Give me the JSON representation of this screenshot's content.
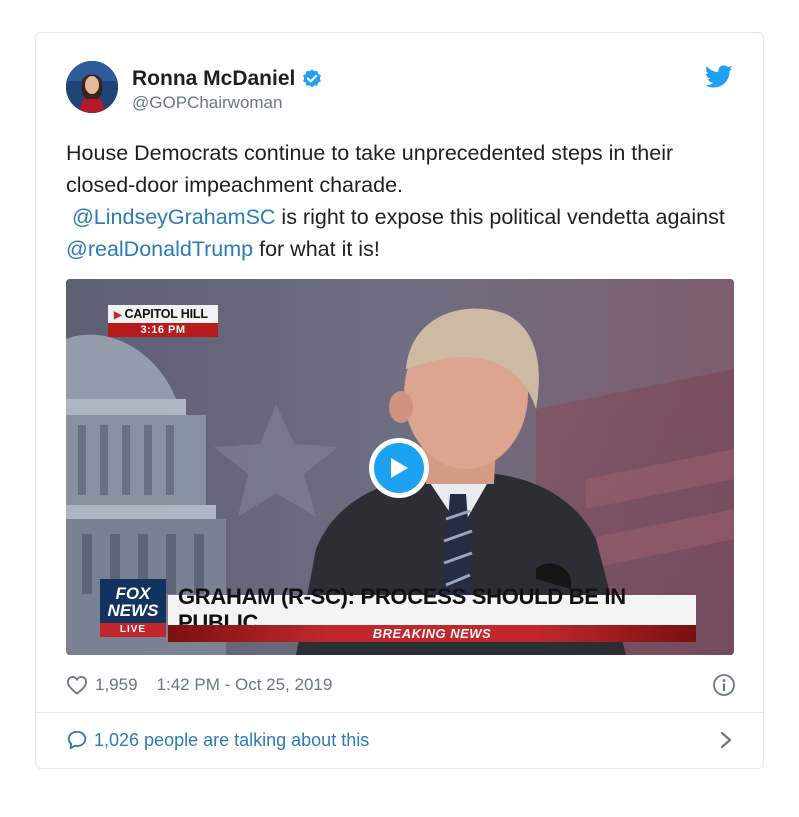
{
  "tweet": {
    "author_name": "Ronna McDaniel",
    "handle": "@GOPChairwoman",
    "text": {
      "line1": "House Democrats continue to take unprecedented steps in their closed-door impeachment charade.",
      "mention1": "@LindseyGrahamSC",
      "mid": " is right to expose this political vendetta against ",
      "mention2": "@realDonaldTrump",
      "end": " for what it is!"
    },
    "likes": "1,959",
    "timestamp": "1:42 PM - Oct 25, 2019",
    "conversation": "1,026 people are talking about this"
  },
  "video": {
    "location_label": "CAPITOL HILL",
    "location_time": "3:16 PM",
    "network_logo_line1": "FOX",
    "network_logo_line2": "NEWS",
    "network_logo_line3": "LIVE",
    "chyron": "GRAHAM (R-SC): PROCESS SHOULD BE IN PUBLIC",
    "breaking_label": "BREAKING NEWS"
  },
  "icons": {
    "verified": "verified-badge-icon",
    "brand": "twitter-bird-icon",
    "like": "heart-icon",
    "info": "info-icon",
    "reply": "speech-bubble-icon",
    "more": "chevron-right-icon",
    "play": "play-icon"
  },
  "colors": {
    "accent": "#1da1f2",
    "link": "#2b7bb9",
    "muted": "#697882",
    "breaking_red": "#c0282b"
  }
}
